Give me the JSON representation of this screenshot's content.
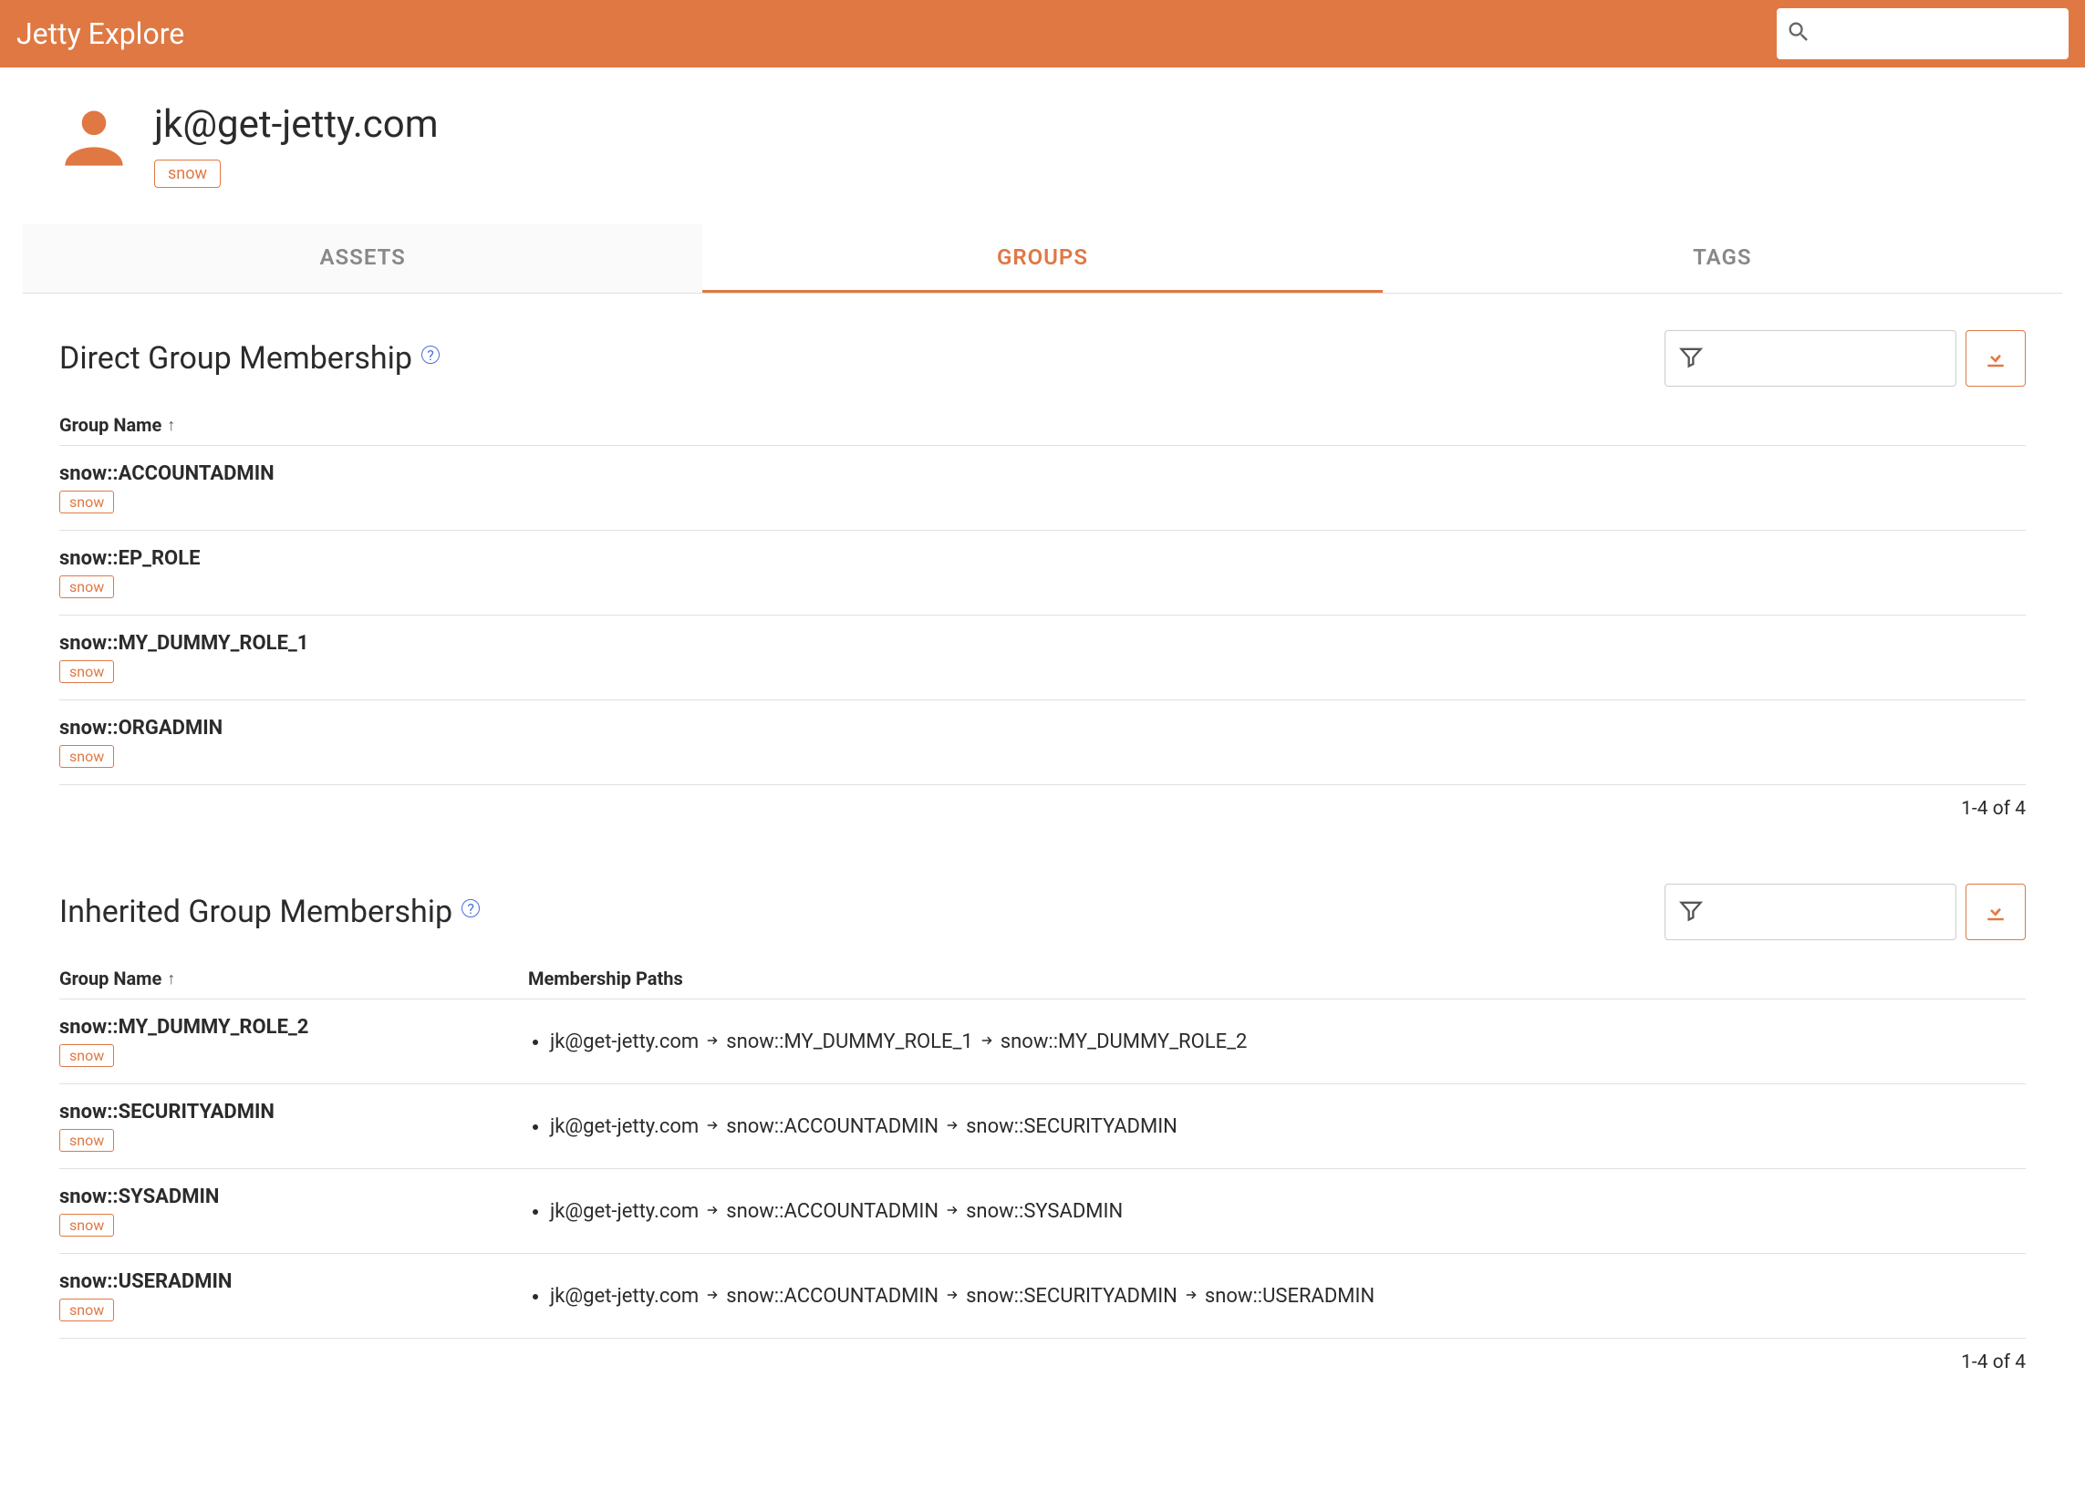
{
  "header": {
    "title": "Jetty Explore",
    "search_placeholder": ""
  },
  "user": {
    "email": "jk@get-jetty.com",
    "badge": "snow"
  },
  "tabs": {
    "assets": "ASSETS",
    "groups": "GROUPS",
    "tags": "TAGS",
    "active": "groups"
  },
  "direct": {
    "title": "Direct Group Membership",
    "col_name": "Group Name",
    "rows": [
      {
        "name": "snow::ACCOUNTADMIN",
        "badge": "snow"
      },
      {
        "name": "snow::EP_ROLE",
        "badge": "snow"
      },
      {
        "name": "snow::MY_DUMMY_ROLE_1",
        "badge": "snow"
      },
      {
        "name": "snow::ORGADMIN",
        "badge": "snow"
      }
    ],
    "pager": "1-4 of 4"
  },
  "inherited": {
    "title": "Inherited Group Membership",
    "col_name": "Group Name",
    "col_paths": "Membership Paths",
    "rows": [
      {
        "name": "snow::MY_DUMMY_ROLE_2",
        "badge": "snow",
        "path": [
          "jk@get-jetty.com",
          "snow::MY_DUMMY_ROLE_1",
          "snow::MY_DUMMY_ROLE_2"
        ]
      },
      {
        "name": "snow::SECURITYADMIN",
        "badge": "snow",
        "path": [
          "jk@get-jetty.com",
          "snow::ACCOUNTADMIN",
          "snow::SECURITYADMIN"
        ]
      },
      {
        "name": "snow::SYSADMIN",
        "badge": "snow",
        "path": [
          "jk@get-jetty.com",
          "snow::ACCOUNTADMIN",
          "snow::SYSADMIN"
        ]
      },
      {
        "name": "snow::USERADMIN",
        "badge": "snow",
        "path": [
          "jk@get-jetty.com",
          "snow::ACCOUNTADMIN",
          "snow::SECURITYADMIN",
          "snow::USERADMIN"
        ]
      }
    ],
    "pager": "1-4 of 4"
  }
}
